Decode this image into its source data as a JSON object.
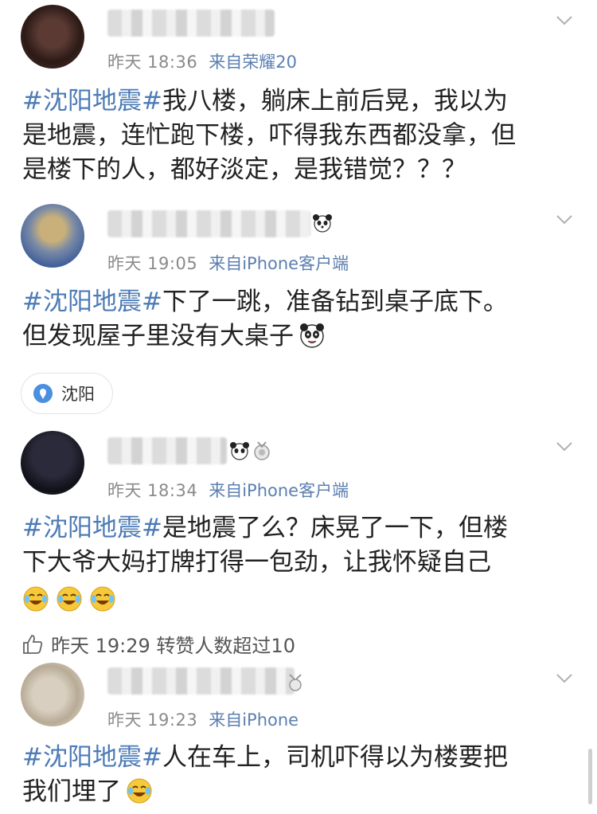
{
  "posts": [
    {
      "time": "昨天 18:36",
      "source": "来自荣耀20",
      "tag": "#沈阳地震#",
      "text_line1": "我八楼，躺床上前后晃，我以为",
      "text_line2": "是地震，连忙跑下楼，吓得我东西都没拿，但",
      "text_line3": "是楼下的人，都好淡定，是我错觉？？？"
    },
    {
      "time": "昨天 19:05",
      "source": "来自iPhone客户端",
      "tag": "#沈阳地震#",
      "text_line1": "下了一跳，准备钻到桌子底下。",
      "text_line2": "但发现屋子里没有大桌子",
      "location": "沈阳"
    },
    {
      "time": "昨天 18:34",
      "source": "来自iPhone客户端",
      "tag": "#沈阳地震#",
      "text_line1": "是地震了么？床晃了一下，但楼",
      "text_line2": "下大爷大妈打牌打得一包劲，让我怀疑自己",
      "footer": "昨天  19:29  转赞人数超过10"
    },
    {
      "time": "昨天 19:23",
      "source": "来自iPhone",
      "tag": "#沈阳地震#",
      "text_line1": "人在车上，司机吓得以为楼要把",
      "text_line2": "我们埋了"
    }
  ],
  "colors": {
    "hashtag": "#4c7bb6",
    "meta": "#8a8a8a",
    "text": "#222222"
  },
  "icons": [
    "chevron-down-icon",
    "location-pin-icon",
    "like-thumb-icon",
    "panda-emoji-icon",
    "laugh-cry-emoji-icon"
  ]
}
